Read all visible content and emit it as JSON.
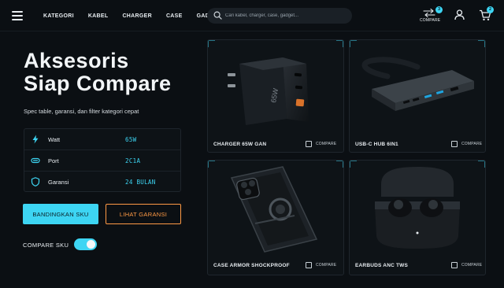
{
  "nav": {
    "items": [
      "KATEGORI",
      "KABEL",
      "CHARGER",
      "CASE",
      "GADGET"
    ]
  },
  "search": {
    "placeholder": "Cari kabel, charger, case, gadget..."
  },
  "header_actions": {
    "compare_label": "COMPARE",
    "compare_count": "3",
    "cart_count": "2"
  },
  "hero": {
    "title_line1": "Aksesoris",
    "title_line2": "Siap Compare",
    "subtitle": "Spec table, garansi, dan filter kategori cepat"
  },
  "specs": [
    {
      "key": "Watt",
      "value": "65W",
      "icon": "bolt-icon"
    },
    {
      "key": "Port",
      "value": "2C1A",
      "icon": "port-icon"
    },
    {
      "key": "Garansi",
      "value": "24 BULAN",
      "icon": "shield-icon"
    }
  ],
  "buttons": {
    "primary": "BANDINGKAN SKU",
    "secondary": "LIHAT GARANSI"
  },
  "toggle": {
    "label": "COMPARE SKU",
    "on": true
  },
  "products": [
    {
      "name": "CHARGER 65W GAN",
      "compare_label": "COMPARE"
    },
    {
      "name": "USB-C HUB 6IN1",
      "compare_label": "COMPARE"
    },
    {
      "name": "CASE ARMOR SHOCKPROOF",
      "compare_label": "COMPARE"
    },
    {
      "name": "EARBUDS ANC TWS",
      "compare_label": "COMPARE"
    }
  ],
  "colors": {
    "accent": "#3dd5f3",
    "secondary": "#ff9a45",
    "background": "#0b0f13"
  }
}
